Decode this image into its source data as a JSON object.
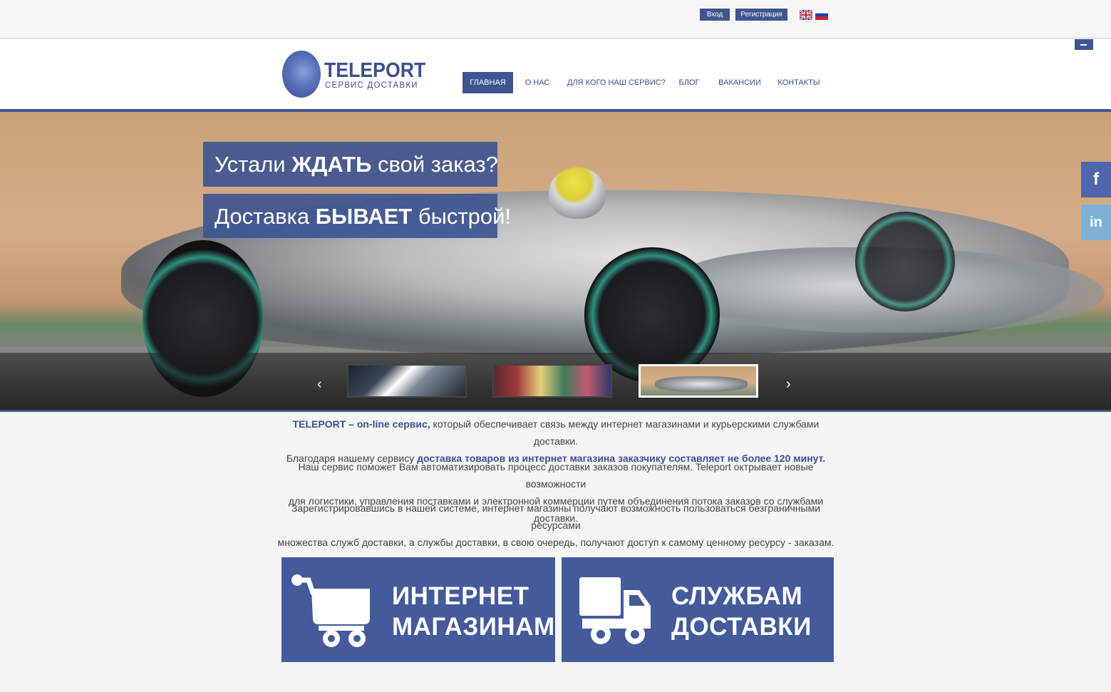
{
  "topbar": {
    "login_label": "Вход",
    "register_label": "Регистрация",
    "languages": [
      "english-flag-icon",
      "russian-flag-icon"
    ]
  },
  "header": {
    "logo_title": "TELEPORT",
    "logo_subtitle": "СЕРВИС ДОСТАВКИ",
    "nav": [
      {
        "label": "ГЛАВНАЯ",
        "active": true
      },
      {
        "label": "О НАС",
        "active": false
      },
      {
        "label": "ДЛЯ КОГО НАШ СЕРВИС?",
        "active": false
      },
      {
        "label": "БЛОГ",
        "active": false
      },
      {
        "label": "ВАКАНСИИ",
        "active": false
      },
      {
        "label": "КОНТАКТЫ",
        "active": false
      }
    ]
  },
  "hero": {
    "line1_pre": "Устали ",
    "line1_bold": "ЖДАТЬ",
    "line1_post": " свой заказ?",
    "line2_pre": "Доставка ",
    "line2_bold": "БЫВАЕТ",
    "line2_post": " быстрой!",
    "selected_thumb": 3
  },
  "social": {
    "facebook": "f",
    "linkedin": "in"
  },
  "intro": {
    "p1_brand": "TELEPORT – on-line сервис,",
    "p1_text": " который обеспечивает связь между интернет магазинами и курьерскими службами доставки.",
    "p1b_text": "Благодаря нашему сервису ",
    "p1b_hl": "доставка товаров из интернет магазина заказчику составляет не более 120 минут.",
    "p2_line1": "Наш сервис поможет Вам автоматизировать процесс доставки заказов покупателям. Teleport октрывает новые возможности",
    "p2_line2": "для логистики, управления поставками и электронной коммерции путем объединения потока заказов со службами доставки.",
    "p3_line1": "Зарегистрировавшись в нашей системе, интернет магазины получают возможность пользоваться безграничными ресурсами",
    "p3_line2": "множества  служб доставки, а службы доставки, в свою очередь, получают доступ к самому ценному ресурсу - заказам."
  },
  "cards": {
    "shops_line1": "ИНТЕРНЕТ",
    "shops_line2": "МАГАЗИНАМ",
    "delivery_line1": "СЛУЖБАМ",
    "delivery_line2": "ДОСТАВКИ"
  },
  "colors": {
    "brand": "#3e5590",
    "card": "#435a9b",
    "facebook": "#4e66ad",
    "linkedin": "#7db2d6"
  }
}
